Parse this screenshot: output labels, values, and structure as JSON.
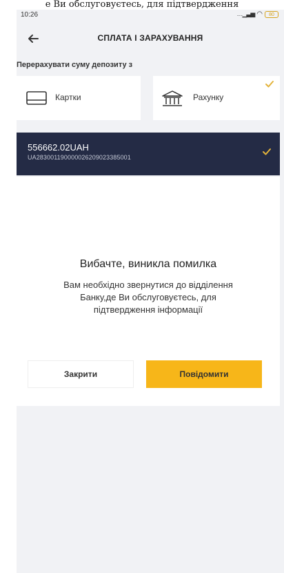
{
  "overlay_caption": "е Ви обслуговуєтесь, для підтвердження",
  "status_bar": {
    "time": "10:26",
    "battery": "80"
  },
  "header": {
    "title": "СПЛАТА І ЗАРАХУВАННЯ",
    "back_icon": "arrow-left-icon"
  },
  "section_label": "Перерахувати суму депозиту з",
  "sources": [
    {
      "label": "Картки",
      "icon": "card-icon",
      "selected": false
    },
    {
      "label": "Рахунку",
      "icon": "bank-icon",
      "selected": true
    }
  ],
  "account": {
    "amount": "556662.02UAH",
    "iban": "UA283001190000026209023385001",
    "selected": true
  },
  "dialog": {
    "title": "Вибачте, виникла помилка",
    "message": "Вам необхідно звернутися до відділення Банку,де Ви обслуговуєтесь, для підтвердження інформації",
    "close_label": "Закрити",
    "notify_label": "Повідомити"
  },
  "colors": {
    "accent": "#f7b619",
    "account_bg": "#242b45",
    "check": "#e3b33a",
    "background": "#f1f2f5"
  }
}
